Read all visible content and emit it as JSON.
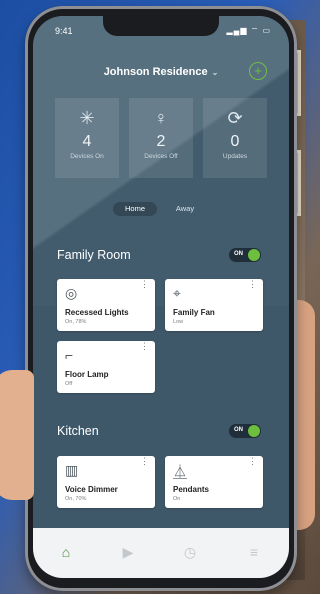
{
  "status_bar": {
    "time": "9:41",
    "system": "▂▄▆ ⌔ ▭"
  },
  "header": {
    "title": "Johnson Residence",
    "caret": "⌄",
    "add_icon": "+"
  },
  "stats": [
    {
      "icon": "lightbulb-on-icon",
      "glyph": "✳",
      "value": "4",
      "label": "Devices On"
    },
    {
      "icon": "lightbulb-off-icon",
      "glyph": "♀",
      "value": "2",
      "label": "Devices Off"
    },
    {
      "icon": "refresh-icon",
      "glyph": "⟳",
      "value": "0",
      "label": "Updates"
    }
  ],
  "modes": {
    "home": "Home",
    "away": "Away"
  },
  "rooms": [
    {
      "name": "Family Room",
      "toggle": "ON",
      "devices": [
        {
          "name": "Recessed Lights",
          "status": "On, 78%",
          "icon": "recessed-light-icon",
          "glyph": "◎"
        },
        {
          "name": "Family Fan",
          "status": "Low",
          "icon": "ceiling-fan-icon",
          "glyph": "⌖"
        },
        {
          "name": "Floor Lamp",
          "status": "Off",
          "icon": "floor-lamp-icon",
          "glyph": "⌐"
        }
      ]
    },
    {
      "name": "Kitchen",
      "toggle": "ON",
      "devices": [
        {
          "name": "Voice Dimmer",
          "status": "On, 70%",
          "icon": "voice-dimmer-icon",
          "glyph": "▥"
        },
        {
          "name": "Pendants",
          "status": "On",
          "icon": "pendant-light-icon",
          "glyph": "⏅"
        }
      ]
    }
  ],
  "tabbar": [
    {
      "name": "home-tab",
      "glyph": "⌂",
      "active": true
    },
    {
      "name": "play-tab",
      "glyph": "▶",
      "active": false
    },
    {
      "name": "clock-tab",
      "glyph": "◷",
      "active": false
    },
    {
      "name": "menu-tab",
      "glyph": "≡",
      "active": false
    }
  ],
  "colors": {
    "accent": "#6fbf3f",
    "screen_bg": "#425c6d"
  }
}
